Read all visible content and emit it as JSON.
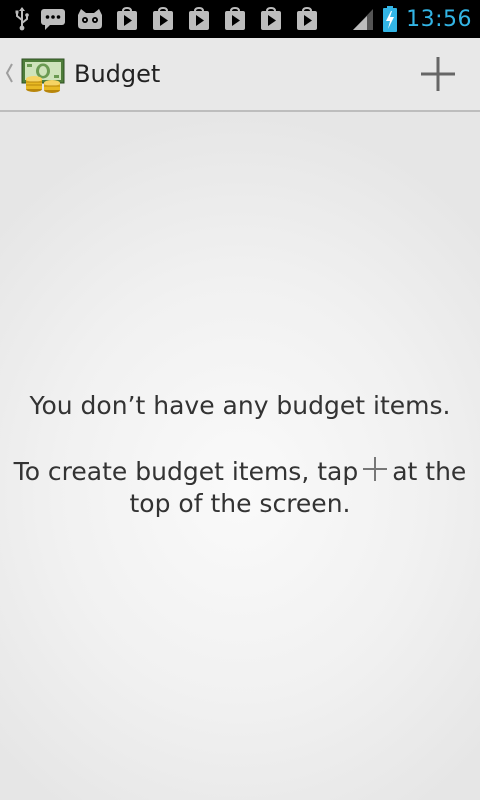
{
  "status_bar": {
    "time": "13:56",
    "left_icons": [
      "usb-icon",
      "chat-icon",
      "cyanogen-icon",
      "play-store-icon",
      "play-store-icon",
      "play-store-icon",
      "play-store-icon",
      "play-store-icon",
      "play-store-icon"
    ],
    "right_icons": [
      "signal-icon",
      "battery-charging-icon"
    ],
    "accent_color": "#33b5e5"
  },
  "action_bar": {
    "title": "Budget",
    "add_icon": "plus-icon",
    "app_icon": "money-icon"
  },
  "empty_state": {
    "message": "You don’t have any budget items.",
    "hint_before": "To create budget items, tap",
    "hint_after": "at the top of the screen.",
    "hint_icon": "plus-icon"
  }
}
